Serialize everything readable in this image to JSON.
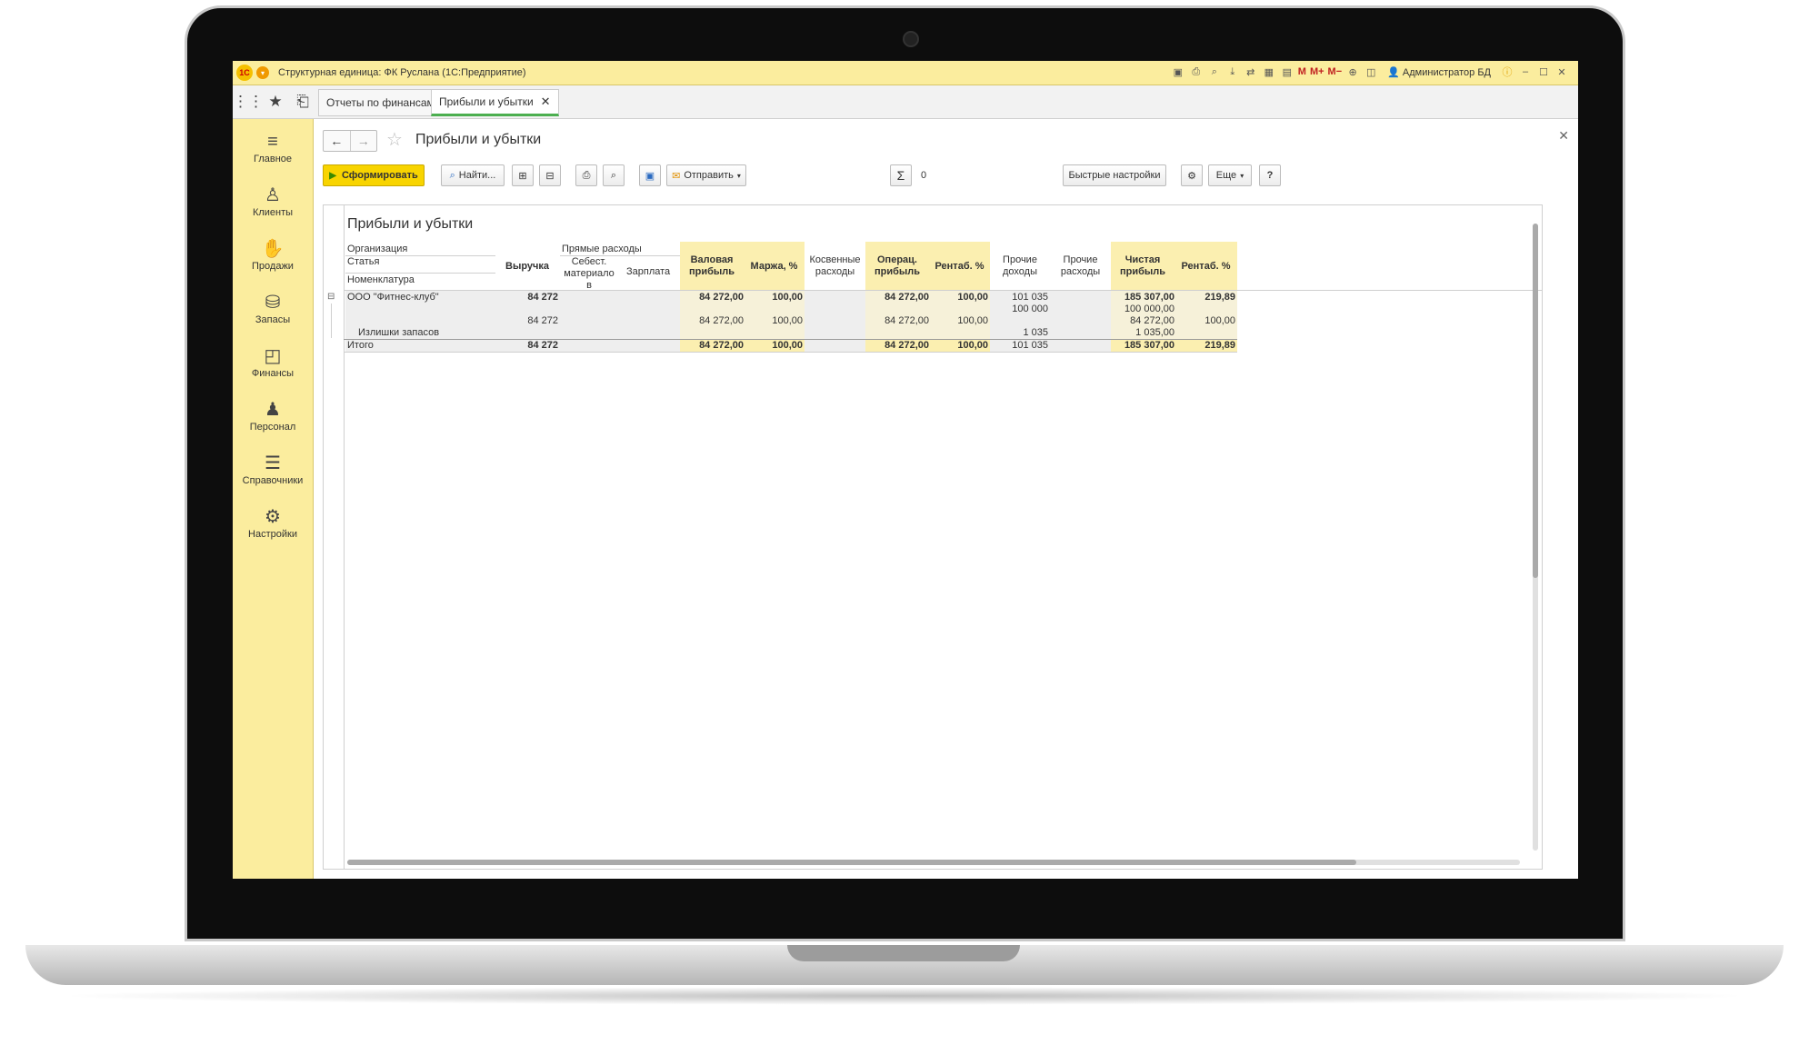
{
  "window": {
    "title": "Структурная единица: ФК Руслана  (1С:Предприятие)",
    "logo": "1С",
    "user": "Администратор БД",
    "memory_buttons": [
      "M",
      "M+",
      "M−"
    ]
  },
  "tabs": [
    {
      "label": "Отчеты по финансам"
    },
    {
      "label": "Прибыли и убытки"
    }
  ],
  "sidebar": {
    "items": [
      {
        "label": "Главное",
        "icon": "menu-icon"
      },
      {
        "label": "Клиенты",
        "icon": "person-icon"
      },
      {
        "label": "Продажи",
        "icon": "sales-icon"
      },
      {
        "label": "Запасы",
        "icon": "stock-icon"
      },
      {
        "label": "Финансы",
        "icon": "wallet-icon"
      },
      {
        "label": "Персонал",
        "icon": "staff-icon"
      },
      {
        "label": "Справочники",
        "icon": "books-icon"
      },
      {
        "label": "Настройки",
        "icon": "gear-icon"
      }
    ]
  },
  "page": {
    "title": "Прибыли и убытки"
  },
  "toolbar": {
    "generate": "Сформировать",
    "find": "Найти...",
    "send": "Отправить",
    "sum_value": "0",
    "quick_settings": "Быстрые настройки",
    "more": "Еще",
    "help": "?"
  },
  "report": {
    "title": "Прибыли и убытки",
    "headers": {
      "organization": "Организация",
      "article": "Статья",
      "nomenclature": "Номенклатура",
      "revenue": "Выручка",
      "direct_costs": "Прямые расходы",
      "cost_line1": "Себест.",
      "cost_line2": "материало",
      "cost_line3": "в",
      "salary": "Зарплата",
      "gross_line1": "Валовая",
      "gross_line2": "прибыль",
      "margin": "Маржа, %",
      "indirect_line1": "Косвенные",
      "indirect_line2": "расходы",
      "oper_line1": "Операц.",
      "oper_line2": "прибыль",
      "rent1": "Рентаб. %",
      "other_inc_line1": "Прочие",
      "other_inc_line2": "доходы",
      "other_exp_line1": "Прочие",
      "other_exp_line2": "расходы",
      "net_line1": "Чистая",
      "net_line2": "прибыль",
      "rent2": "Рентаб. %"
    },
    "rows": [
      {
        "name": "ООО \"Фитнес-клуб\"",
        "revenue": "84 272",
        "gross": "84 272,00",
        "margin": "100,00",
        "oper": "84 272,00",
        "rent1": "100,00",
        "other_inc": "101 035",
        "net": "185 307,00",
        "rent2": "219,89"
      },
      {
        "name": "",
        "revenue": "",
        "gross": "",
        "margin": "",
        "oper": "",
        "rent1": "",
        "other_inc": "100 000",
        "net": "100 000,00",
        "rent2": ""
      },
      {
        "name": "",
        "revenue": "84 272",
        "gross": "84 272,00",
        "margin": "100,00",
        "oper": "84 272,00",
        "rent1": "100,00",
        "other_inc": "",
        "net": "84 272,00",
        "rent2": "100,00"
      },
      {
        "name": "Излишки запасов",
        "revenue": "",
        "gross": "",
        "margin": "",
        "oper": "",
        "rent1": "",
        "other_inc": "1 035",
        "net": "1 035,00",
        "rent2": ""
      }
    ],
    "total": {
      "name": "Итого",
      "revenue": "84 272",
      "gross": "84 272,00",
      "margin": "100,00",
      "oper": "84 272,00",
      "rent1": "100,00",
      "other_inc": "101 035",
      "net": "185 307,00",
      "rent2": "219,89"
    }
  }
}
